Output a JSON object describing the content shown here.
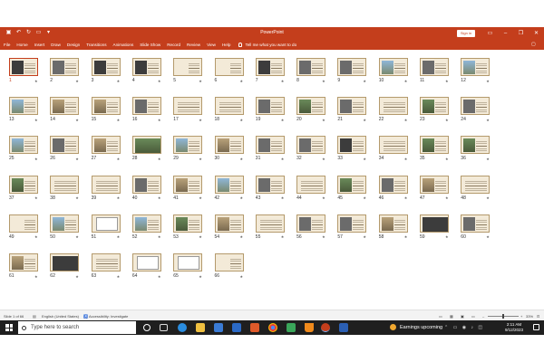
{
  "app": {
    "title": "PowerPoint",
    "sign_in_label": "Sign in"
  },
  "ribbon": {
    "tabs": [
      "File",
      "Home",
      "Insert",
      "Draw",
      "Design",
      "Transitions",
      "Animations",
      "Slide Show",
      "Record",
      "Review",
      "View",
      "Help"
    ],
    "tell_me": "Tell me what you want to do"
  },
  "slides": {
    "selected": 1,
    "numbers": [
      "1",
      "2",
      "3",
      "4",
      "5",
      "6",
      "7",
      "8",
      "9",
      "10",
      "11",
      "12",
      "13",
      "14",
      "15",
      "16",
      "17",
      "18",
      "19",
      "20",
      "21",
      "22",
      "23",
      "24",
      "25",
      "26",
      "27",
      "28",
      "29",
      "30",
      "31",
      "32",
      "33",
      "34",
      "35",
      "36",
      "37",
      "38",
      "39",
      "40",
      "41",
      "42",
      "43",
      "44",
      "45",
      "46",
      "47",
      "48",
      "49",
      "50",
      "51",
      "52",
      "53",
      "54",
      "55",
      "56",
      "57",
      "58",
      "59",
      "60",
      "61",
      "62",
      "63",
      "64",
      "65",
      "66"
    ],
    "star_glyph": "★"
  },
  "status": {
    "slide_of": "Slide 1 of 66",
    "language": "English (United States)",
    "accessibility": "Accessibility: Investigate",
    "zoom": "33%"
  },
  "taskbar": {
    "search_placeholder": "Type here to search",
    "weather_text": "Earnings upcoming",
    "time": "2:11 AM",
    "date": "9/12/2023"
  },
  "colors": {
    "accent": "#c43e1c",
    "slide_bg": "#f3ead8",
    "slide_border": "#b49a6c",
    "taskbar": "#1f1f1f"
  }
}
